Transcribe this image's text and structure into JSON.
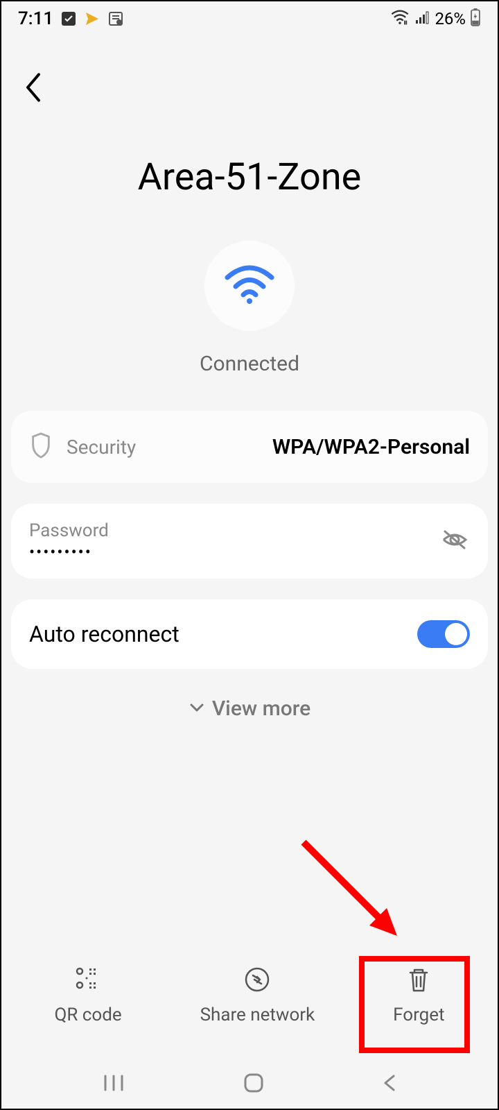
{
  "status": {
    "time": "7:11",
    "battery": "26%"
  },
  "network": {
    "name": "Area-51-Zone",
    "status": "Connected"
  },
  "security": {
    "label": "Security",
    "value": "WPA/WPA2-Personal"
  },
  "password": {
    "label": "Password",
    "value": "•••••••••"
  },
  "auto_reconnect": {
    "label": "Auto reconnect",
    "enabled": true
  },
  "view_more": "View more",
  "actions": {
    "qr": "QR code",
    "share": "Share network",
    "forget": "Forget"
  }
}
